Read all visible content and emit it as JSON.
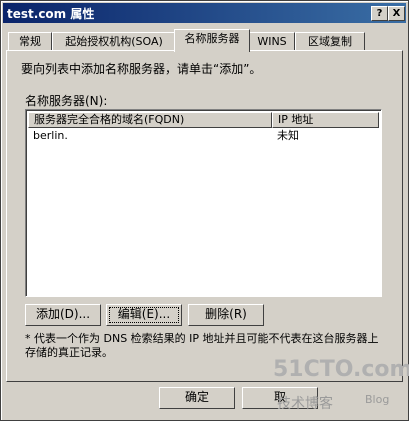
{
  "window": {
    "title": "test.com 属性",
    "help_glyph": "?",
    "close_glyph": "X"
  },
  "tabs": [
    {
      "label": "常规"
    },
    {
      "label": "起始授权机构(SOA)"
    },
    {
      "label": "名称服务器",
      "active": true
    },
    {
      "label": "WINS"
    },
    {
      "label": "区域复制"
    }
  ],
  "intro_text": "要向列表中添加名称服务器，请单击“添加”。",
  "list": {
    "label": "名称服务器(N):",
    "columns": [
      "服务器完全合格的域名(FQDN)",
      "IP 地址"
    ],
    "rows": [
      {
        "fqdn": "berlin.",
        "ip": "未知"
      }
    ]
  },
  "buttons": {
    "add": "添加(D)...",
    "edit": "编辑(E)...",
    "remove": "删除(R)",
    "ok": "确定",
    "cancel": "取"
  },
  "note": "* 代表一个作为 DNS 检索结果的 IP 地址并且可能不代表在这台服务器上存储的真正记录。",
  "watermark": {
    "site": "51CTO.com",
    "text": "技术博客",
    "blog": "Blog"
  }
}
